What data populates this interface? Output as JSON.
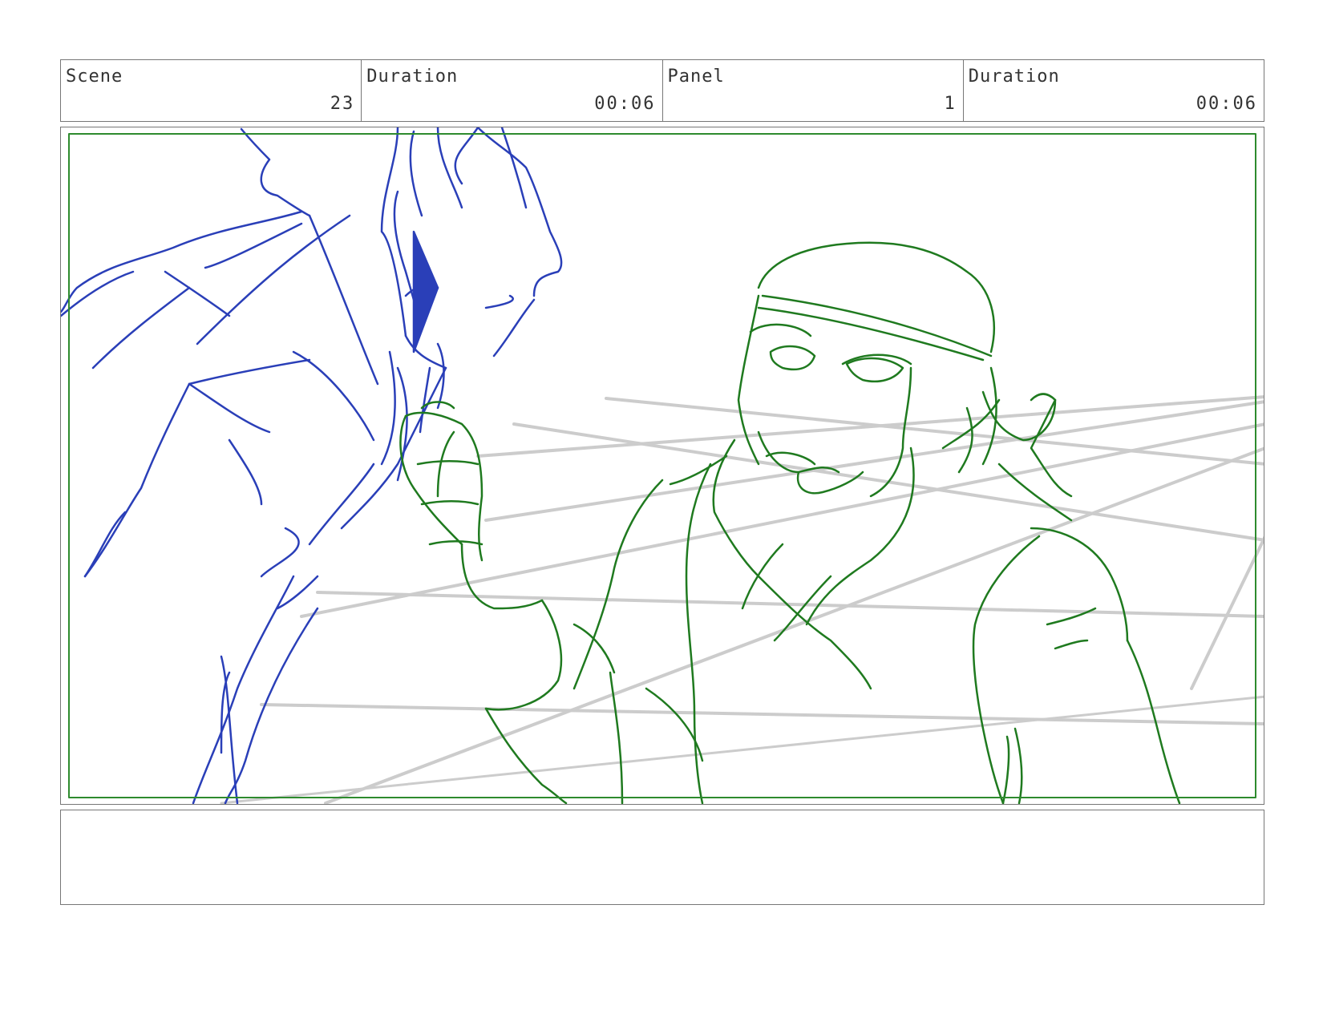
{
  "header": {
    "scene": {
      "label": "Scene",
      "value": "23"
    },
    "scene_duration": {
      "label": "Duration",
      "value": "00:06"
    },
    "panel": {
      "label": "Panel",
      "value": "1"
    },
    "panel_duration": {
      "label": "Duration",
      "value": "00:06"
    }
  },
  "colors": {
    "border": "#777777",
    "safe_frame": "#2e8b2e",
    "character_left": "#2a3fb8",
    "character_right": "#1f7a1f",
    "background_grid": "#cccccc"
  },
  "notes": {
    "text": ""
  }
}
